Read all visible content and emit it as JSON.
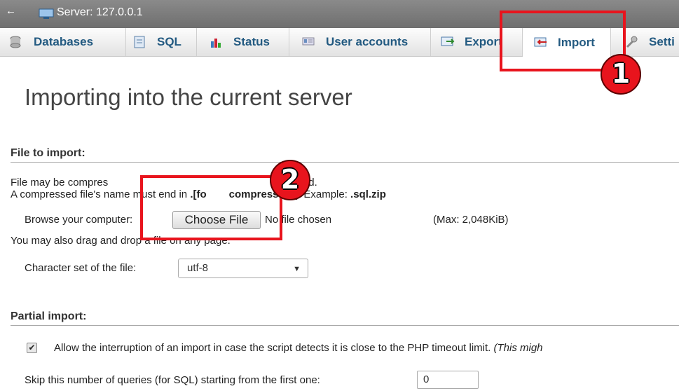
{
  "header": {
    "back_glyph": "←",
    "server_title": "Server: 127.0.0.1"
  },
  "tabs": [
    {
      "label": "Databases",
      "icon": "database-icon"
    },
    {
      "label": "SQL",
      "icon": "sql-icon"
    },
    {
      "label": "Status",
      "icon": "status-icon"
    },
    {
      "label": "User accounts",
      "icon": "user-accounts-icon"
    },
    {
      "label": "Export",
      "icon": "export-icon"
    },
    {
      "label": "Import",
      "icon": "import-icon",
      "active": true
    },
    {
      "label": "Setti",
      "icon": "settings-icon"
    }
  ],
  "page": {
    "title": "Importing into the current server"
  },
  "file_import": {
    "section_title": "File to import:",
    "compress_line1_a": "File may be compres",
    "compress_line1_b": "pressed.",
    "compress_line2_a": "A compressed file's ",
    "compress_line2_b": "name must end in ",
    "compress_line2_c": ".[fo",
    "compress_line2_d": "compression]",
    "compress_line2_e": ". Example: ",
    "compress_line2_f": ".sql.zip",
    "browse_label": "Browse your computer:",
    "choose_file_label": "Choose File",
    "no_file_text": "No file chosen",
    "max_size": "(Max: 2,048KiB)",
    "drag_drop_text": "You may also drag and drop a file on any page.",
    "charset_label": "Character set of the file:",
    "charset_value": "utf-8"
  },
  "partial_import": {
    "section_title": "Partial import:",
    "interrupt_text": "Allow the interruption of an import in case the script detects it is close to the PHP timeout limit. ",
    "interrupt_note": "(This migh",
    "interrupt_checked": true,
    "skip_label": "Skip this number of queries (for SQL) starting from the first one:",
    "skip_value": "0"
  },
  "annotations": [
    {
      "number": "1"
    },
    {
      "number": "2"
    }
  ],
  "colors": {
    "tab_text": "#235a81",
    "annotation_red": "#e8141d"
  }
}
